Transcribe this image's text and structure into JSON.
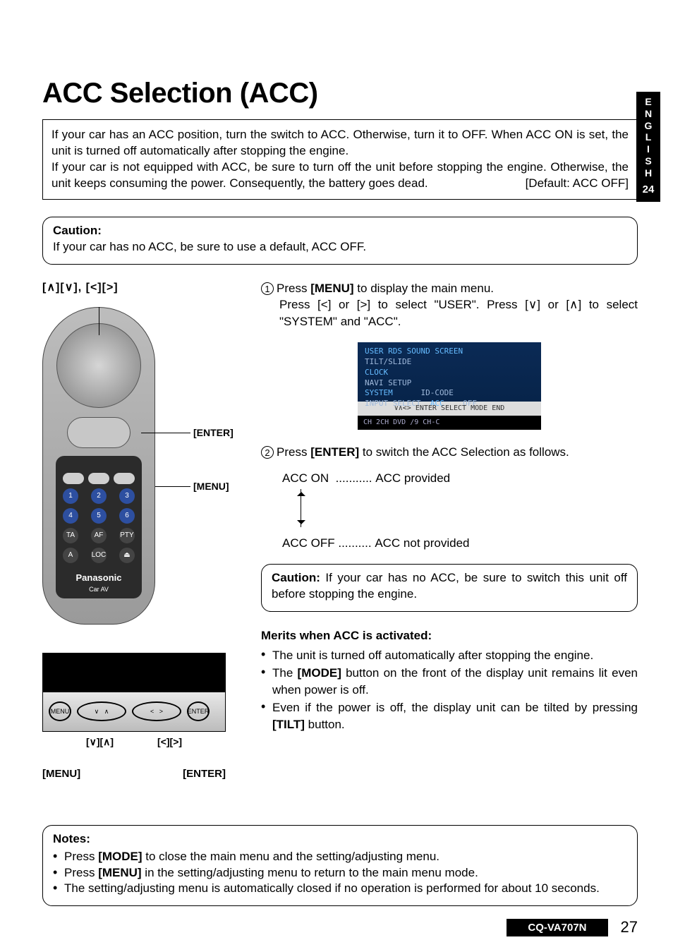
{
  "sidebar": {
    "lang": [
      "E",
      "N",
      "G",
      "L",
      "I",
      "S",
      "H"
    ],
    "num": "24"
  },
  "title": "ACC Selection (ACC)",
  "intro": {
    "p1": "If your car has an ACC position, turn the switch to ACC. Otherwise, turn it to OFF. When ACC ON is set, the unit is turned off automatically after stopping the engine.",
    "p2a": "If your car is not equipped with ACC, be sure to turn off the unit before stopping the engine. Otherwise, the unit keeps consuming the power. Consequently, the battery goes dead.",
    "default": "[Default: ACC OFF]"
  },
  "caution1": {
    "label": "Caution:",
    "text": "If your car has no ACC, be sure to use a default, ACC OFF."
  },
  "left": {
    "keys": "[∧][∨], [<][>]",
    "enter": "[ENTER]",
    "menu": "[MENU]",
    "brand": "Panasonic",
    "carav": "Car AV",
    "unit_keys_left": "[∨][∧]",
    "unit_keys_right": "[<][>]",
    "unit_menu": "[MENU]",
    "unit_enter": "[ENTER]"
  },
  "steps": {
    "s1a": "Press ",
    "s1b": "[MENU]",
    "s1c": " to display the main menu.",
    "s1d": "Press [<] or [>] to select \"USER\". Press [∨] or [∧] to select \"SYSTEM\" and \"ACC\".",
    "s2a": "Press ",
    "s2b": "[ENTER]",
    "s2c": " to switch the ACC Selection as follows."
  },
  "screen": {
    "tabs": "USER  RDS  SOUND  SCREEN",
    "l1": "TILT/SLIDE",
    "l2": "CLOCK",
    "l3": "NAVI SETUP",
    "l4a": "SYSTEM",
    "l4b": "ID-CODE",
    "l5a": "INPUT SELECT",
    "l5b": "ACC",
    "l5c": "OFF",
    "mid": "∨∧<> ENTER  SELECT  MODE  END",
    "bot": "CH 2CH  DVD /9 CH-C"
  },
  "acc": {
    "on": "ACC ON",
    "on_dots": "...........",
    "on_txt": "ACC provided",
    "off": "ACC OFF",
    "off_dots": "..........",
    "off_txt": "ACC not provided"
  },
  "caution2": {
    "label": "Caution:",
    "text": " If your car has no ACC, be sure to switch this unit off before stopping the engine."
  },
  "merits": {
    "title": "Merits when ACC is activated:",
    "m1": "The unit is turned off automatically after stopping the engine.",
    "m2a": "The ",
    "m2b": "[MODE]",
    "m2c": " button on the front of the display unit remains lit even when power is off.",
    "m3a": "Even if the power is off, the display unit can be tilted by pressing ",
    "m3b": "[TILT]",
    "m3c": " button."
  },
  "notes": {
    "title": "Notes:",
    "n1a": "Press ",
    "n1b": "[MODE]",
    "n1c": " to close the main menu and the setting/adjusting menu.",
    "n2a": "Press ",
    "n2b": "[MENU]",
    "n2c": " in the setting/adjusting menu to return to the main menu mode.",
    "n3": "The setting/adjusting menu is automatically closed if no operation is performed for about 10 seconds."
  },
  "footer": {
    "model": "CQ-VA707N",
    "page": "27"
  }
}
